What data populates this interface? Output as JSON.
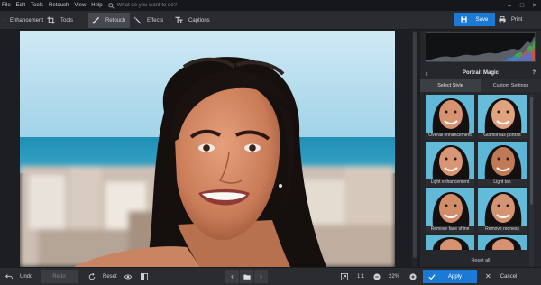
{
  "menu": {
    "items": [
      "File",
      "Edit",
      "Tools",
      "Retouch",
      "View",
      "Help"
    ],
    "search_placeholder": "What do you want to do?"
  },
  "toolbar": {
    "tabs": [
      {
        "label": "Enhancement",
        "icon": "sliders-icon"
      },
      {
        "label": "Tools",
        "icon": "crop-icon"
      },
      {
        "label": "Retouch",
        "icon": "brush-icon",
        "active": true
      },
      {
        "label": "Effects",
        "icon": "magic-wand-icon"
      },
      {
        "label": "Captions",
        "icon": "text-icon"
      }
    ],
    "save_label": "Save",
    "print_label": "Print"
  },
  "panel": {
    "title": "Portrait Magic",
    "help": "?",
    "subtabs": [
      "Select Style",
      "Custom Settings"
    ],
    "active_subtab": "Select Style",
    "styles": [
      "Overall enhancement",
      "Glamorous portrait",
      "Light enhancement",
      "Light tan",
      "Remove face shine",
      "Remove redness"
    ],
    "reset_label": "Reset all"
  },
  "bottom": {
    "undo_label": "Undo",
    "redo_label": "Redo",
    "reset_label": "Reset",
    "zoom_ratio_label": "1:1",
    "zoom_percent": "22%",
    "apply_label": "Apply",
    "cancel_label": "Cancel"
  },
  "colors": {
    "accent": "#1b7ad6",
    "active_tab": "#45484e"
  }
}
